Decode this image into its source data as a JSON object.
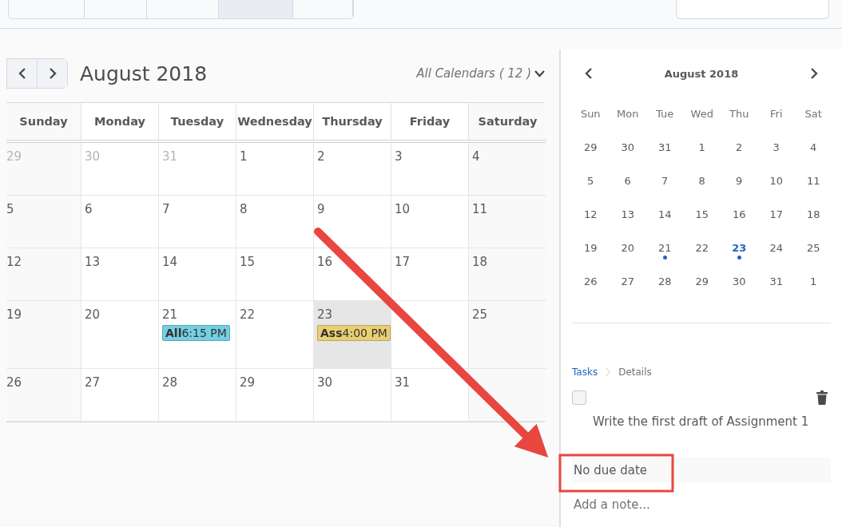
{
  "top_tabs": [
    {
      "selected": false
    },
    {
      "selected": false
    },
    {
      "selected": false
    },
    {
      "selected": true
    },
    {
      "selected": false
    }
  ],
  "calendar": {
    "title": "August 2018",
    "filter": "All Calendars ( 12 )",
    "weekdays": [
      "Sunday",
      "Monday",
      "Tuesday",
      "Wednesday",
      "Thursday",
      "Friday",
      "Saturday"
    ],
    "weeks": [
      [
        {
          "day": "29",
          "muted": true,
          "selected": false
        },
        {
          "day": "30",
          "muted": true,
          "selected": false
        },
        {
          "day": "31",
          "muted": true,
          "selected": false
        },
        {
          "day": "1",
          "muted": false,
          "selected": false
        },
        {
          "day": "2",
          "muted": false,
          "selected": false
        },
        {
          "day": "3",
          "muted": false,
          "selected": false
        },
        {
          "day": "4",
          "muted": false,
          "selected": false
        }
      ],
      [
        {
          "day": "5",
          "muted": false,
          "selected": false
        },
        {
          "day": "6",
          "muted": false,
          "selected": false
        },
        {
          "day": "7",
          "muted": false,
          "selected": false
        },
        {
          "day": "8",
          "muted": false,
          "selected": false
        },
        {
          "day": "9",
          "muted": false,
          "selected": false
        },
        {
          "day": "10",
          "muted": false,
          "selected": false
        },
        {
          "day": "11",
          "muted": false,
          "selected": false
        }
      ],
      [
        {
          "day": "12",
          "muted": false,
          "selected": false
        },
        {
          "day": "13",
          "muted": false,
          "selected": false
        },
        {
          "day": "14",
          "muted": false,
          "selected": false
        },
        {
          "day": "15",
          "muted": false,
          "selected": false
        },
        {
          "day": "16",
          "muted": false,
          "selected": false
        },
        {
          "day": "17",
          "muted": false,
          "selected": false
        },
        {
          "day": "18",
          "muted": false,
          "selected": false
        }
      ],
      [
        {
          "day": "19",
          "muted": false,
          "selected": false
        },
        {
          "day": "20",
          "muted": false,
          "selected": false
        },
        {
          "day": "21",
          "muted": false,
          "selected": false,
          "events": [
            {
              "title": "All",
              "time": "6:15 PM",
              "color": "#74cfe3"
            }
          ]
        },
        {
          "day": "22",
          "muted": false,
          "selected": false
        },
        {
          "day": "23",
          "muted": false,
          "selected": true,
          "events": [
            {
              "title": "Ass",
              "time": "4:00 PM",
              "color": "#e9cf72"
            }
          ]
        },
        {
          "selected": false
        },
        {
          "day": "25",
          "muted": false,
          "selected": false
        }
      ],
      [
        {
          "day": "26",
          "muted": false,
          "selected": false
        },
        {
          "day": "27",
          "muted": false,
          "selected": false
        },
        {
          "day": "28",
          "muted": false,
          "selected": false
        },
        {
          "day": "29",
          "muted": false,
          "selected": false
        },
        {
          "day": "30",
          "muted": false,
          "selected": false
        },
        {
          "day": "31",
          "muted": false,
          "selected": false
        },
        {
          "selected": false
        }
      ]
    ]
  },
  "mini_calendar": {
    "title": "August 2018",
    "weekdays": [
      "Sun",
      "Mon",
      "Tue",
      "Wed",
      "Thu",
      "Fri",
      "Sat"
    ],
    "weeks": [
      [
        {
          "day": "29",
          "selected": false
        },
        {
          "day": "30",
          "selected": false
        },
        {
          "day": "31",
          "selected": false
        },
        {
          "day": "1",
          "selected": false
        },
        {
          "day": "2",
          "selected": false
        },
        {
          "day": "3",
          "selected": false
        },
        {
          "day": "4",
          "selected": false
        }
      ],
      [
        {
          "day": "5",
          "selected": false
        },
        {
          "day": "6",
          "selected": false
        },
        {
          "day": "7",
          "selected": false
        },
        {
          "day": "8",
          "selected": false
        },
        {
          "day": "9",
          "selected": false
        },
        {
          "day": "10",
          "selected": false
        },
        {
          "day": "11",
          "selected": false
        }
      ],
      [
        {
          "day": "12",
          "selected": false
        },
        {
          "day": "13",
          "selected": false
        },
        {
          "day": "14",
          "selected": false
        },
        {
          "day": "15",
          "selected": false
        },
        {
          "day": "16",
          "selected": false
        },
        {
          "day": "17",
          "selected": false
        },
        {
          "day": "18",
          "selected": false
        }
      ],
      [
        {
          "day": "19",
          "selected": false
        },
        {
          "day": "20",
          "selected": false
        },
        {
          "day": "21",
          "has_event": true,
          "selected": false
        },
        {
          "day": "22",
          "selected": false
        },
        {
          "day": "23",
          "has_event": true,
          "selected": true
        },
        {
          "day": "24",
          "selected": false
        },
        {
          "day": "25",
          "selected": false
        }
      ],
      [
        {
          "day": "26",
          "selected": false
        },
        {
          "day": "27",
          "selected": false
        },
        {
          "day": "28",
          "selected": false
        },
        {
          "day": "29",
          "selected": false
        },
        {
          "day": "30",
          "selected": false
        },
        {
          "day": "31",
          "selected": false
        },
        {
          "day": "1",
          "selected": false
        }
      ]
    ]
  },
  "task": {
    "breadcrumb": [
      "Tasks",
      "Details"
    ],
    "checked": false,
    "title": "Write the first draft of Assignment 1",
    "due_date": "No due date",
    "note_placeholder": "Add a note..."
  }
}
